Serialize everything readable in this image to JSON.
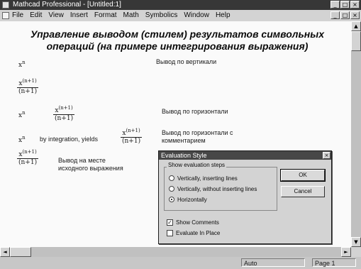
{
  "window": {
    "title": "Mathcad Professional - [Untitled:1]",
    "buttons": [
      "_",
      "□",
      "×"
    ]
  },
  "menubar": {
    "items": [
      "File",
      "Edit",
      "View",
      "Insert",
      "Format",
      "Math",
      "Symbolics",
      "Window",
      "Help"
    ],
    "doc_buttons": [
      "_",
      "□",
      "×"
    ]
  },
  "worksheet": {
    "heading_line1": "Управление выводом (стилем) результатов символьных",
    "heading_line2": "операций (на примере интегрирования выражения)",
    "label_vertical": "Вывод по вертикали",
    "label_horizontal": "Вывод по горизонтали",
    "label_horizontal_comment_1": "Вывод по горизонтали с",
    "label_horizontal_comment_2": "комментарием",
    "label_in_place_1": "Вывод на месте",
    "label_in_place_2": "исходного выражения",
    "expr_base": "x",
    "expr_exp": "n",
    "result_num_base": "x",
    "result_num_exp": "(n+1)",
    "result_den": "(n+1)",
    "comment_text": "by integration, yields"
  },
  "dialog": {
    "title": "Evaluation Style",
    "close": "×",
    "group_label": "Show evaluation steps",
    "options": [
      "Vertically, inserting lines",
      "Vertically, without inserting lines",
      "Horizontally"
    ],
    "selected_option": "Horizontally",
    "ok": "OK",
    "cancel": "Cancel",
    "show_comments": "Show Comments",
    "show_comments_checked": true,
    "evaluate_in_place": "Evaluate In Place",
    "evaluate_in_place_checked": false,
    "check_mark": "✓"
  },
  "scroll": {
    "up": "▲",
    "down": "▼",
    "left": "◄",
    "right": "►"
  },
  "statusbar": {
    "mode": "Auto",
    "page": "Page 1"
  }
}
